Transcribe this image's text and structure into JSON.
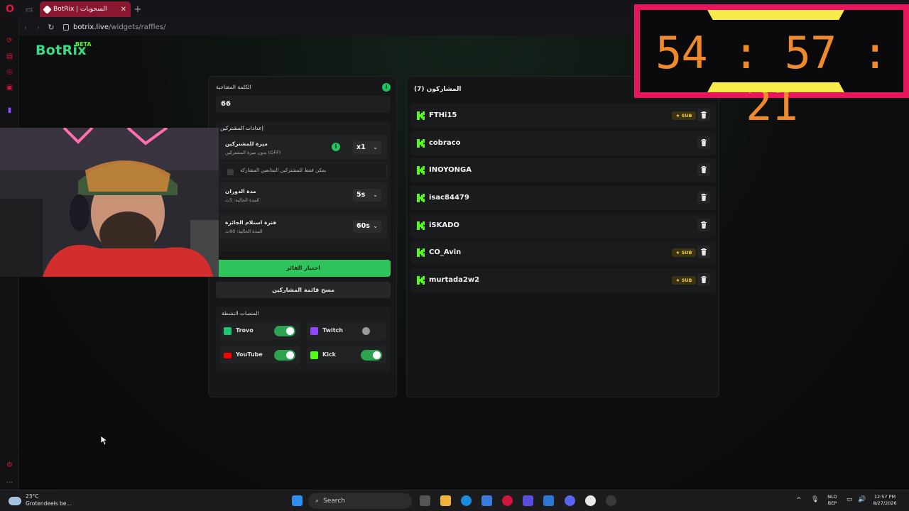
{
  "browser": {
    "tab_title": "BotRix | السحوبات",
    "url_host": "botrix.live",
    "url_path": "/widgets/raffles/"
  },
  "brand": {
    "name": "BotRix",
    "badge": "BETA"
  },
  "settings": {
    "keyword_label": "الكلمة المفتاحية",
    "keyword_value": "66",
    "participant_settings_title": "إعدادات المشتركين",
    "subscriber_bonus_title": "ميزة للمشتركين",
    "subscriber_bonus_sub": "بدون ميزة المشتركين (OFF)",
    "subscriber_bonus_value": "x1",
    "followers_only_label": "يمكن فقط للمشتركين المتابعين المشاركة",
    "spin_duration_title": "مدة الدوران",
    "spin_duration_sub": "المدة الحالية: 5ث",
    "spin_duration_value": "5s",
    "claim_period_title": "فترة استلام الجائزة",
    "claim_period_sub": "المدة الحالية: 60ث",
    "claim_period_value": "60s",
    "pick_winner_label": "اختيار الفائز",
    "clear_list_label": "مسح قائمة المشاركين"
  },
  "platforms": {
    "title": "المنصات النشطة",
    "items": [
      {
        "name": "Trovo",
        "enabled": true,
        "color": "#1bc66f"
      },
      {
        "name": "Twitch",
        "enabled": false,
        "color": "#9146ff"
      },
      {
        "name": "YouTube",
        "enabled": true,
        "color": "#ff0000"
      },
      {
        "name": "Kick",
        "enabled": true,
        "color": "#53fc18"
      }
    ]
  },
  "participants": {
    "title": "المشاركون (7)",
    "sub_badge": "SUB",
    "items": [
      {
        "name": "FTHi15",
        "sub": true
      },
      {
        "name": "cobraco",
        "sub": false
      },
      {
        "name": "INOYONGA",
        "sub": false
      },
      {
        "name": "isac84479",
        "sub": false
      },
      {
        "name": "iSKADO",
        "sub": false
      },
      {
        "name": "CO_Avin",
        "sub": true
      },
      {
        "name": "murtada2w2",
        "sub": true
      }
    ]
  },
  "timer": {
    "value": "54 : 57 : 21"
  },
  "taskbar": {
    "temperature": "23°C",
    "weather_text": "Grotendeels be...",
    "search_placeholder": "Search",
    "lang_line1": "NLD",
    "lang_line2": "BEP",
    "time": "12:57 PM",
    "date": "8/27/2026"
  },
  "colors": {
    "accent_green": "#2fc55c",
    "kick_green": "#53fc18",
    "timer_frame": "#e8175d",
    "timer_digits": "#ef8a2c",
    "timer_bars": "#f7ea4b"
  }
}
